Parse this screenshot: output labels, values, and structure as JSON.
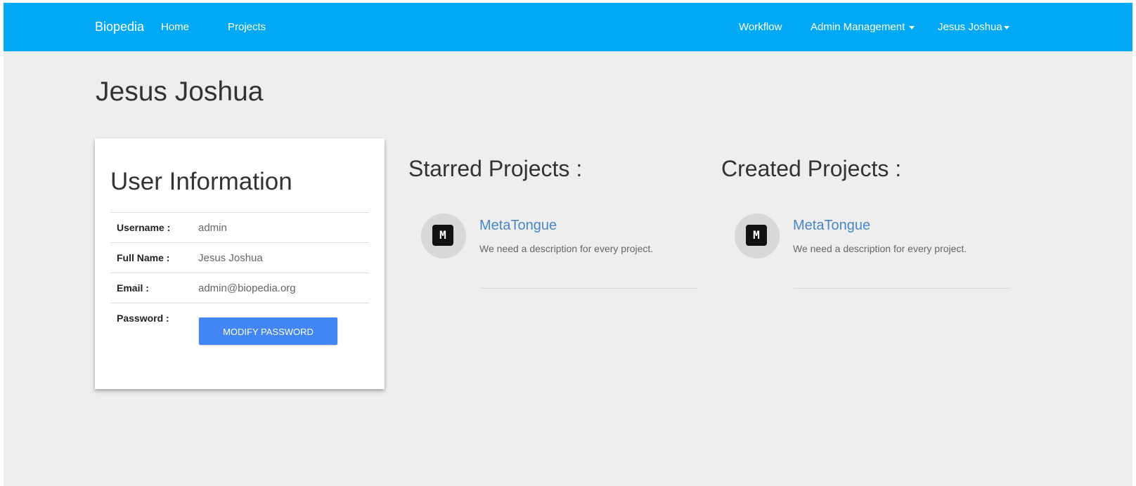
{
  "navbar": {
    "brand": "Biopedia",
    "left_links": [
      "Home",
      "Projects"
    ],
    "right_links": [
      "Workflow",
      "Admin Management",
      "Jesus Joshua"
    ]
  },
  "page_title": "Jesus Joshua",
  "user_info": {
    "title": "User Information",
    "rows": [
      {
        "label": "Username :",
        "value": "admin"
      },
      {
        "label": "Full Name :",
        "value": "Jesus Joshua"
      },
      {
        "label": "Email :",
        "value": "admin@biopedia.org"
      },
      {
        "label": "Password :"
      }
    ],
    "modify_password_label": "MODIFY PASSWORD"
  },
  "starred": {
    "title": "Starred Projects :",
    "projects": [
      {
        "name": "MetaTongue",
        "description": "We need a description for every project.",
        "avatar_text": "M"
      }
    ]
  },
  "created": {
    "title": "Created Projects :",
    "projects": [
      {
        "name": "MetaTongue",
        "description": "We need a description for every project.",
        "avatar_text": "M"
      }
    ]
  },
  "colors": {
    "navbar": "#03a9f4",
    "page_background": "#eeeeee",
    "button": "#4285f4",
    "link": "#4a86c8"
  }
}
